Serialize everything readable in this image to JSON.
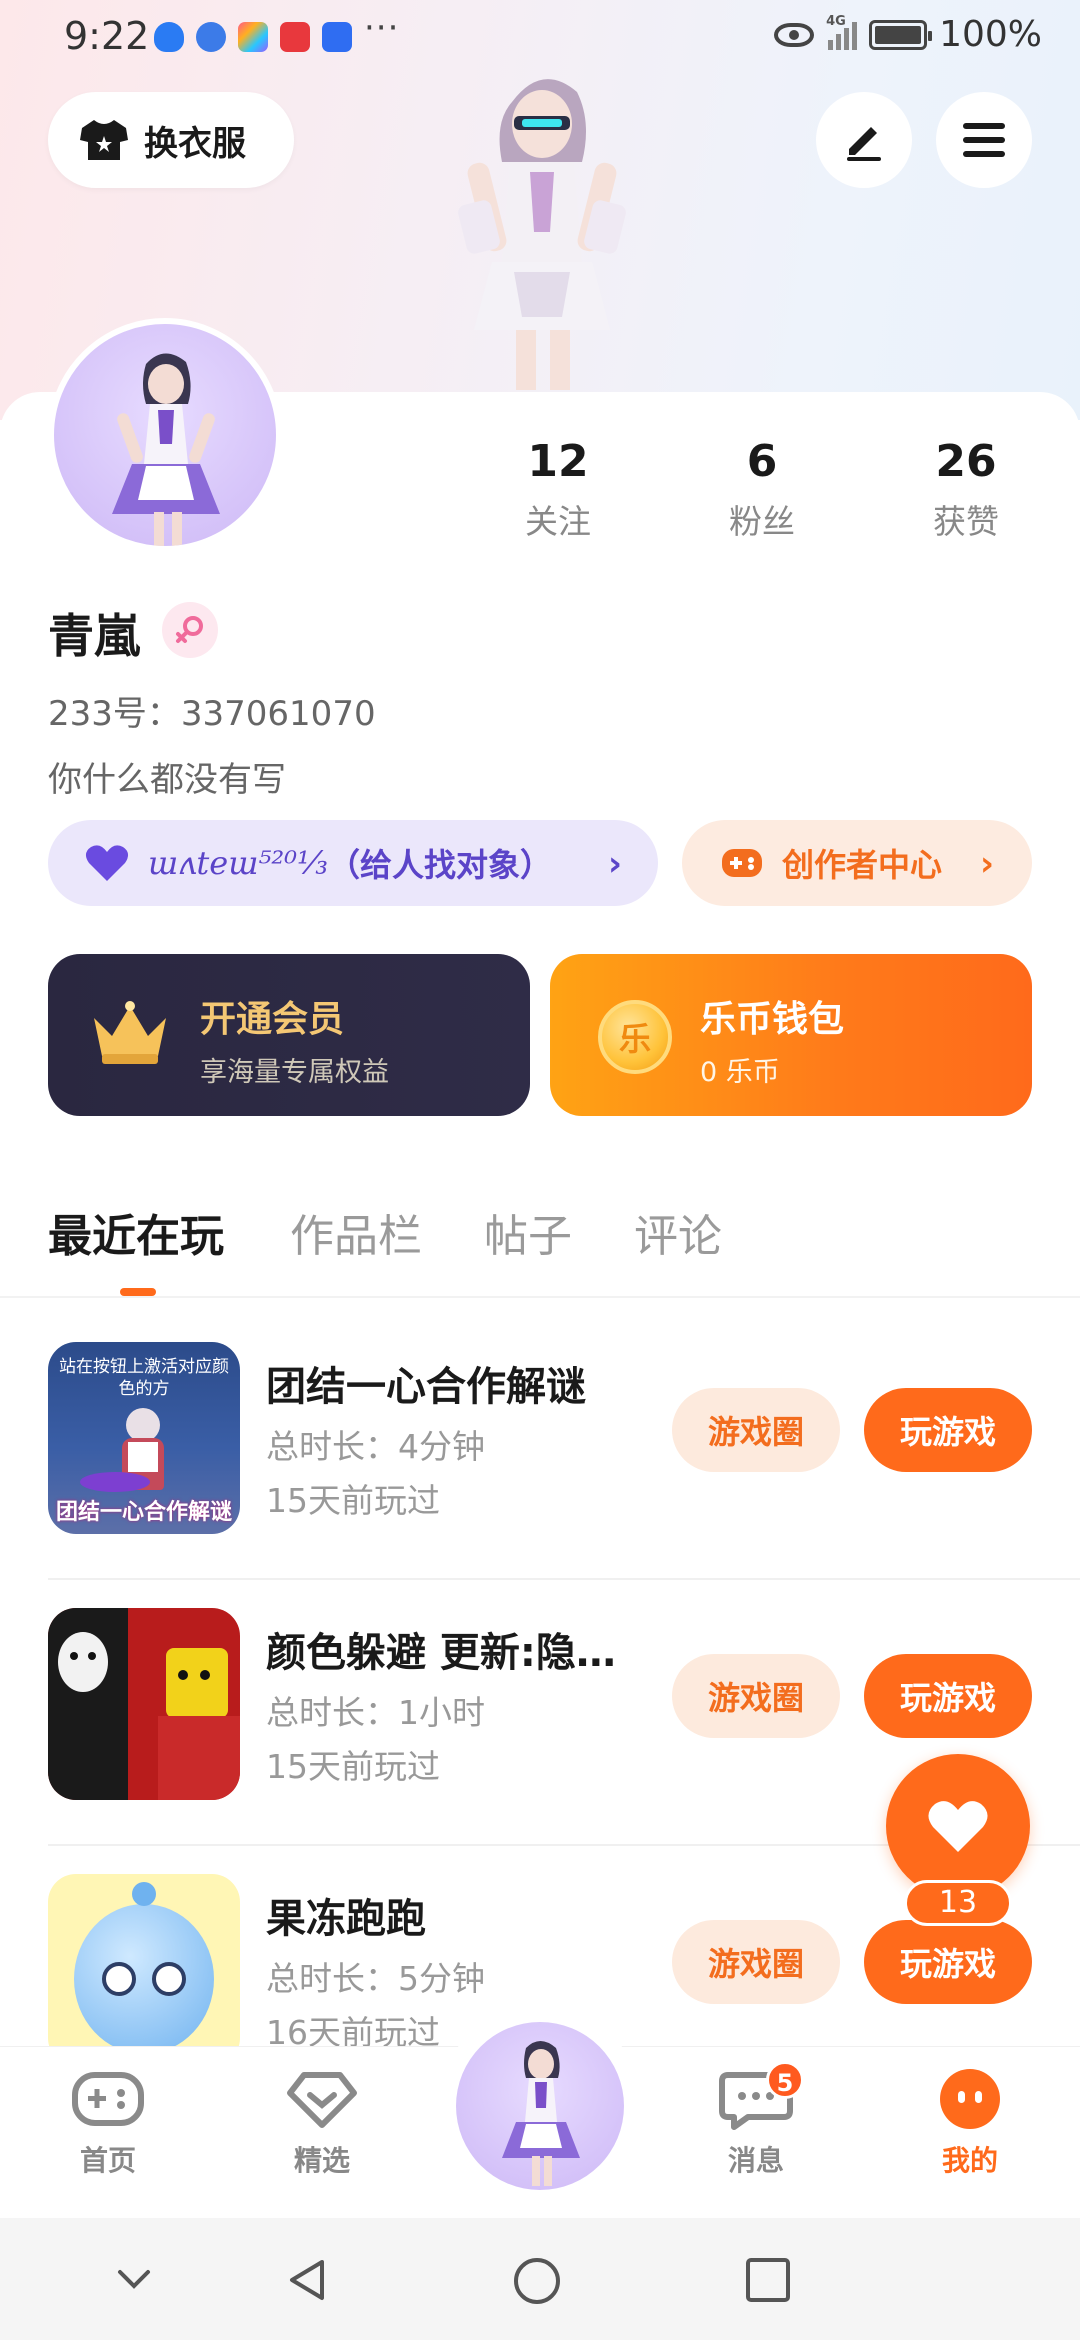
{
  "status_bar": {
    "time": "9:22",
    "dots": "···",
    "signal_label": "4G",
    "battery": "100%"
  },
  "header": {
    "outfit_label": "换衣服",
    "edit_icon": "pencil-icon",
    "menu_icon": "menu-icon"
  },
  "profile": {
    "stats": [
      {
        "value": "12",
        "label": "关注"
      },
      {
        "value": "6",
        "label": "粉丝"
      },
      {
        "value": "26",
        "label": "获赞"
      }
    ],
    "username": "青嵐",
    "uid": "233号：337061070",
    "bio": "你什么都没有写",
    "cp_script": "ɯʌteɯ⁵²⁰¹⁄₃",
    "cp_text": "（给人找对象）",
    "creator_label": "创作者中心"
  },
  "cards": {
    "vip_title": "开通会员",
    "vip_sub": "享海量专属权益",
    "wallet_title": "乐币钱包",
    "wallet_sub": "0 乐币",
    "coin_char": "乐"
  },
  "tabs": [
    "最近在玩",
    "作品栏",
    "帖子",
    "评论"
  ],
  "games": [
    {
      "title": "团结一心合作解谜",
      "duration": "总时长：4分钟",
      "last_played": "15天前玩过",
      "thumb_text_top": "站在按钮上激活对应颜色的方",
      "thumb_text_bottom": "团结一心合作解谜"
    },
    {
      "title": "颜色躲避 更新:隐…",
      "duration": "总时长：1小时",
      "last_played": "15天前玩过"
    },
    {
      "title": "果冻跑跑",
      "duration": "总时长：5分钟",
      "last_played": "16天前玩过"
    }
  ],
  "game_buttons": {
    "circle": "游戏圈",
    "play": "玩游戏"
  },
  "fab": {
    "count": "13"
  },
  "bottom_nav": [
    {
      "label": "首页"
    },
    {
      "label": "精选"
    },
    {
      "label": "消息",
      "badge": "5"
    },
    {
      "label": "我的"
    }
  ],
  "colors": {
    "accent": "#ff6a1b",
    "purple": "#5b44c8",
    "vip_gold": "#f4c774"
  }
}
